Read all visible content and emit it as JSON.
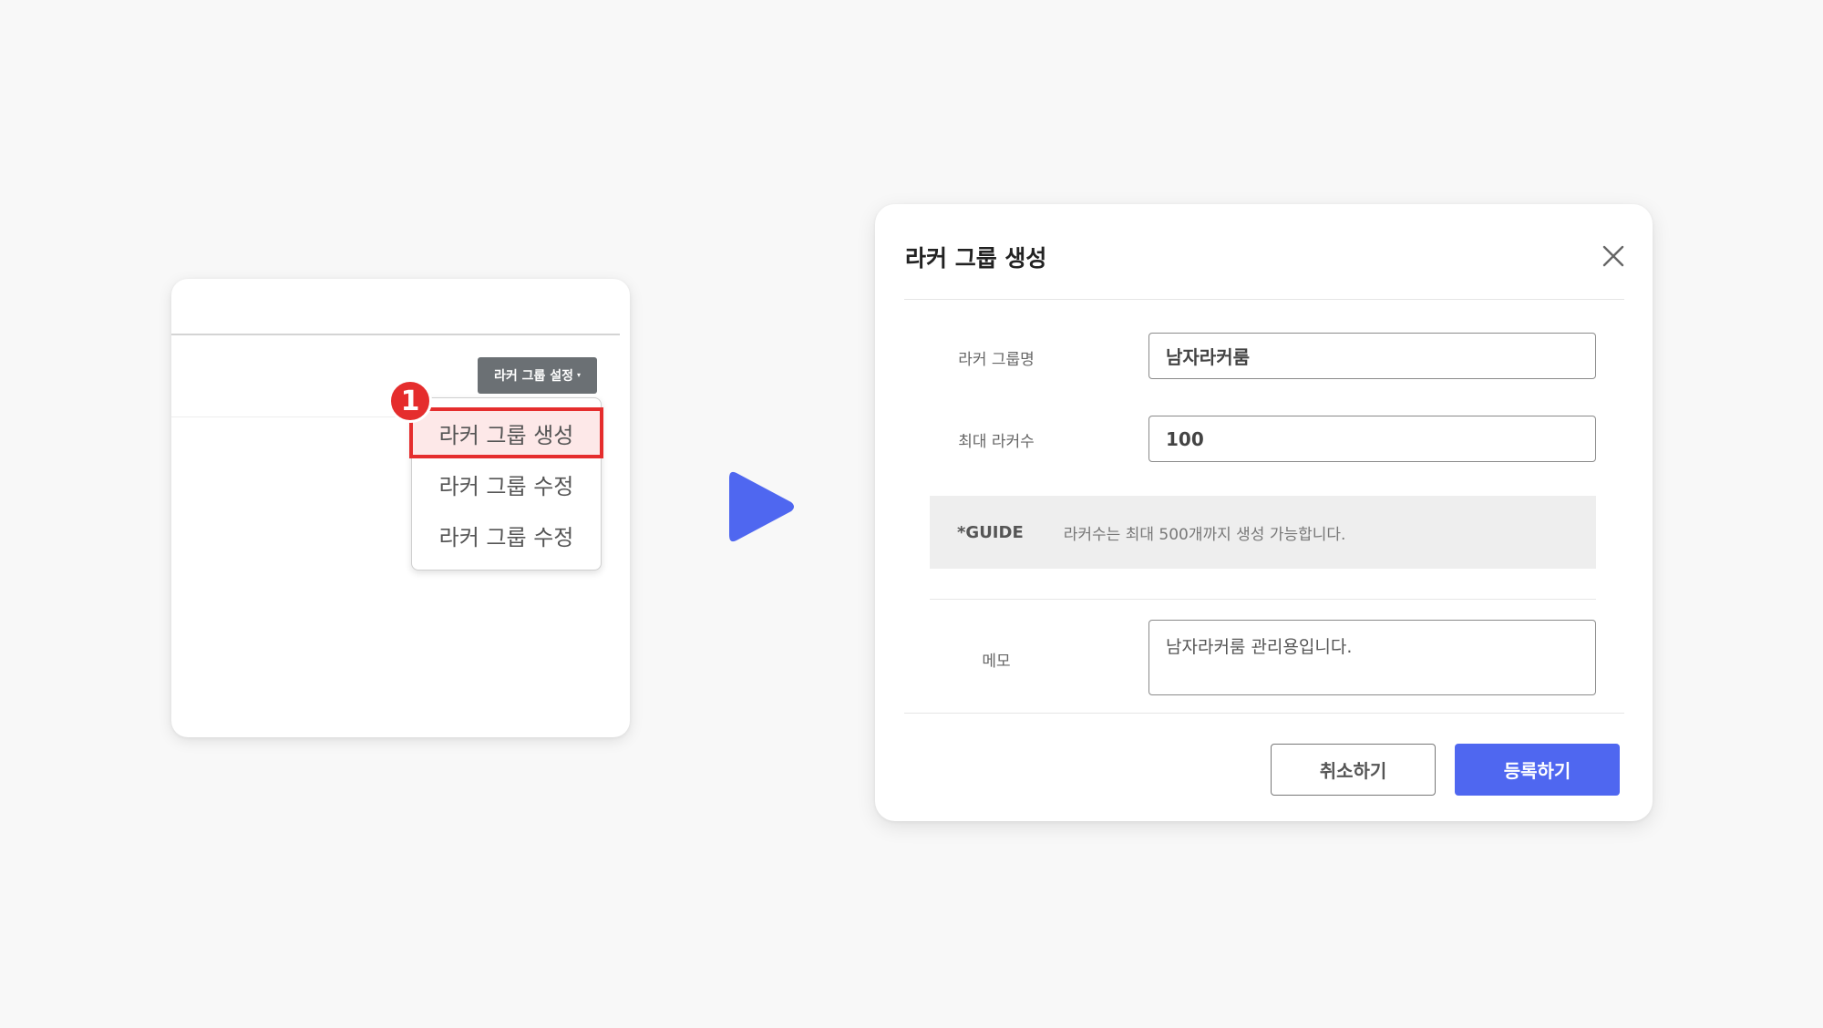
{
  "left_panel": {
    "settings_button_label": "라커 그룹 설정",
    "settings_button_caret": "▾",
    "step_number": "1",
    "menu_items": [
      {
        "label": "라커 그룹 생성",
        "selected": true
      },
      {
        "label": "라커 그룹 수정",
        "selected": false
      },
      {
        "label": "라커 그룹 수정",
        "selected": false
      }
    ],
    "highlight_color": "#e52d2d"
  },
  "arrow": {
    "icon": "play-arrow-icon",
    "color": "#4f67f0"
  },
  "dialog": {
    "title": "라커 그룹 생성",
    "close_icon": "close-icon",
    "fields": {
      "group_name": {
        "label": "라커 그룹명",
        "value": "남자라커룸"
      },
      "max_lockers": {
        "label": "최대 라커수",
        "value": "100"
      }
    },
    "guide": {
      "tag": "*GUIDE",
      "text": "라커수는 최대 500개까지 생성 가능합니다."
    },
    "memo": {
      "label": "메모",
      "value": "남자라커룸 관리용입니다."
    },
    "buttons": {
      "cancel": "취소하기",
      "submit": "등록하기"
    },
    "accent_color": "#4f67f0"
  }
}
